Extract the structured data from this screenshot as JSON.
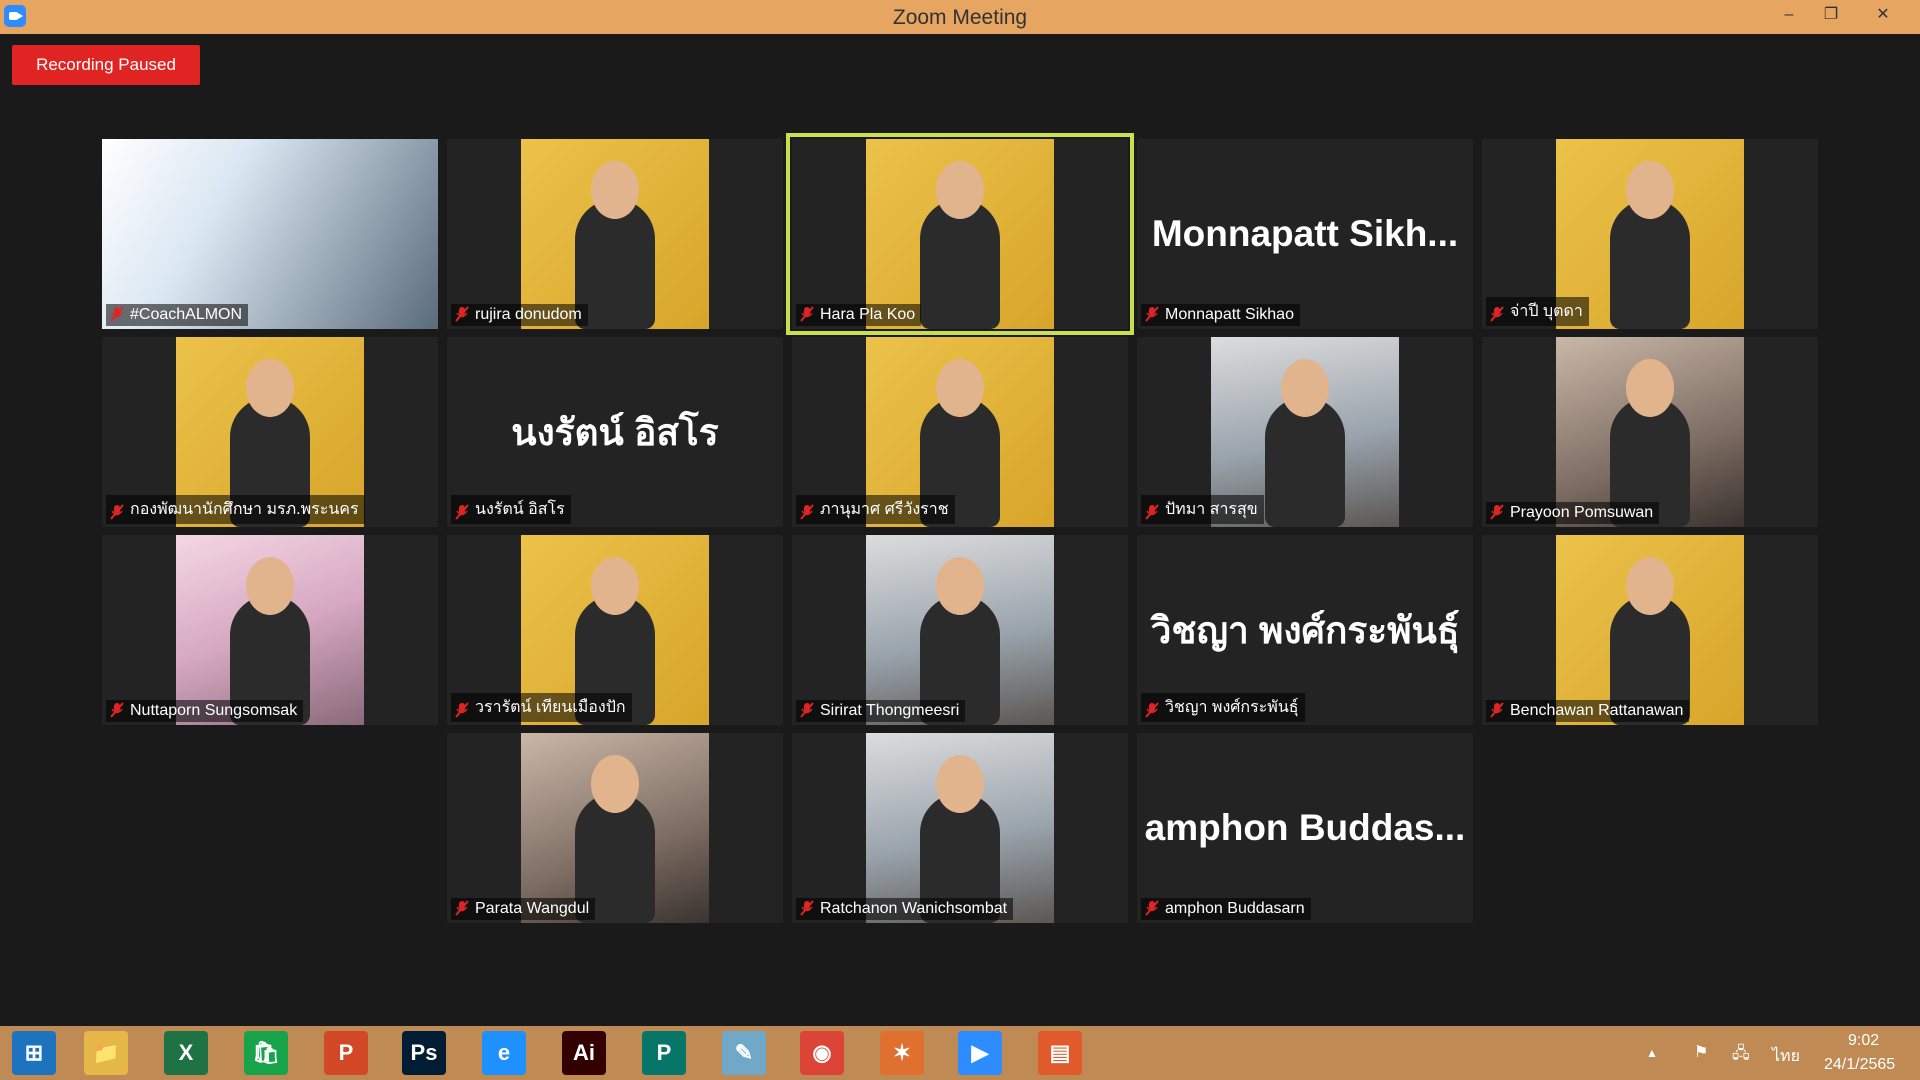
{
  "window": {
    "title": "Zoom Meeting",
    "minimize": "–",
    "restore": "❐",
    "close": "✕"
  },
  "recording": {
    "label": "Recording Paused"
  },
  "participants": [
    {
      "label": "#CoachALMON",
      "big": "",
      "kind": "wide"
    },
    {
      "label": "rujira donudom",
      "big": "",
      "kind": "yellow"
    },
    {
      "label": "Hara Pla Koo",
      "big": "",
      "kind": "yellow",
      "active": true
    },
    {
      "label": "Monnapatt Sikhao",
      "big": "Monnapatt Sikh...",
      "kind": "none"
    },
    {
      "label": "จ่าปี บุตดา",
      "big": "",
      "kind": "yellow"
    },
    {
      "label": "กองพัฒนานักศึกษา มรภ.พระนคร",
      "big": "",
      "kind": "yellow"
    },
    {
      "label": "นงรัตน์ อิสโร",
      "big": "นงรัตน์ อิสโร",
      "kind": "none"
    },
    {
      "label": "ภานุมาศ ศรีวังราช",
      "big": "",
      "kind": "yellow"
    },
    {
      "label": "ปัทมา สารสุข",
      "big": "",
      "kind": "photo2"
    },
    {
      "label": "Prayoon Pomsuwan",
      "big": "",
      "kind": "photo"
    },
    {
      "label": "Nuttaporn Sungsomsak",
      "big": "",
      "kind": "photo3"
    },
    {
      "label": "วรารัตน์ เทียนเมืองปัก",
      "big": "",
      "kind": "yellow"
    },
    {
      "label": "Sirirat Thongmeesri",
      "big": "",
      "kind": "photo2"
    },
    {
      "label": "วิชญา พงศ์กระพันธุ์",
      "big": "วิชญา พงศ์กระพันธุ์",
      "kind": "none"
    },
    {
      "label": "Benchawan Rattanawan",
      "big": "",
      "kind": "yellow"
    },
    {
      "label": "Parata Wangdul",
      "big": "",
      "kind": "photo"
    },
    {
      "label": "Ratchanon Wanichsombat",
      "big": "",
      "kind": "photo2"
    },
    {
      "label": "amphon Buddasarn",
      "big": "amphon Buddas...",
      "kind": "none"
    }
  ],
  "taskbar": {
    "apps": [
      {
        "name": "windows-start-icon",
        "glyph": "⊞",
        "color": "#1e73be"
      },
      {
        "name": "file-explorer-icon",
        "glyph": "📁",
        "color": "#e6b84a"
      },
      {
        "name": "excel-icon",
        "glyph": "X",
        "color": "#1f7244"
      },
      {
        "name": "store-icon",
        "glyph": "🛍",
        "color": "#17a34a"
      },
      {
        "name": "powerpoint-icon",
        "glyph": "P",
        "color": "#d24726"
      },
      {
        "name": "photoshop-icon",
        "glyph": "Ps",
        "color": "#001d34"
      },
      {
        "name": "internet-explorer-icon",
        "glyph": "e",
        "color": "#1e90ff"
      },
      {
        "name": "illustrator-icon",
        "glyph": "Ai",
        "color": "#330000"
      },
      {
        "name": "publisher-icon",
        "glyph": "P",
        "color": "#077568"
      },
      {
        "name": "notes-icon",
        "glyph": "✎",
        "color": "#6fa8c8"
      },
      {
        "name": "chrome-icon",
        "glyph": "◉",
        "color": "#db4437"
      },
      {
        "name": "app-icon",
        "glyph": "✶",
        "color": "#e07030"
      },
      {
        "name": "zoom-icon",
        "glyph": "▶",
        "color": "#2d8cff"
      },
      {
        "name": "slides-icon",
        "glyph": "▤",
        "color": "#e05a2b"
      }
    ],
    "tray": {
      "arrow": "▲",
      "lang": "ไทย",
      "time": "9:02",
      "date": "24/1/2565"
    }
  }
}
